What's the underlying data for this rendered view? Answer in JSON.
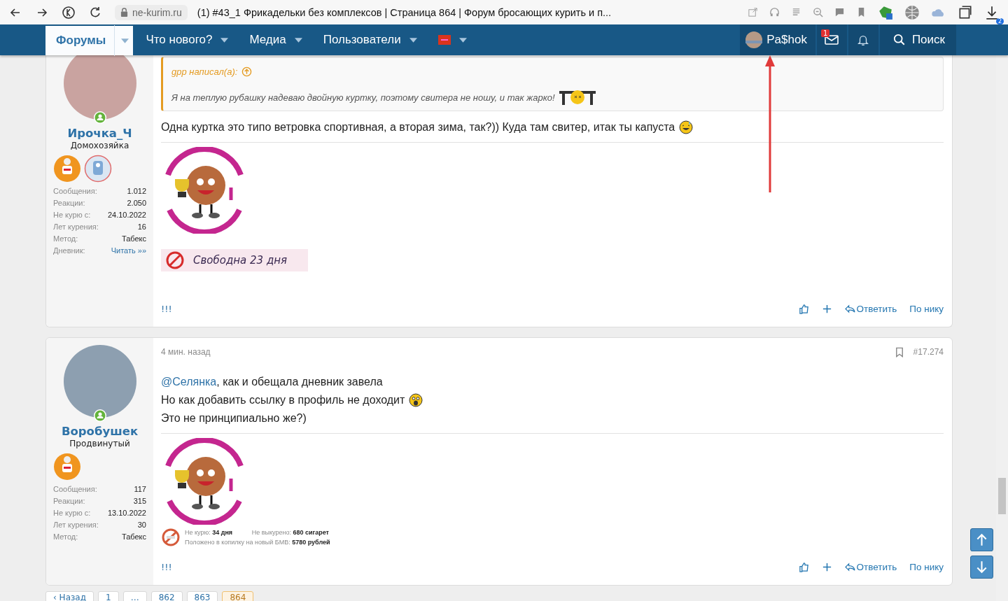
{
  "browser": {
    "url": "ne-kurim.ru",
    "tab_title": "(1) #43_1 Фрикадельки без комплексов | Страница 864 | Форум бросающих курить и п...",
    "downloads_badge": "2"
  },
  "nav": {
    "items": [
      {
        "label": "Форумы",
        "kind": "text",
        "selected": true
      },
      {
        "label": "Что нового?",
        "kind": "text",
        "selected": false
      },
      {
        "label": "Медиа",
        "kind": "text",
        "selected": false
      },
      {
        "label": "Пользователи",
        "kind": "text",
        "selected": false
      },
      {
        "kind": "sos",
        "selected": false
      }
    ],
    "user": "Pa$hok",
    "messages_badge": "1",
    "search": "Поиск"
  },
  "posts": [
    {
      "author": "Ирочка_Ч",
      "title": "Домохозяйка",
      "online": true,
      "awards": [
        {
          "kind": "chef"
        },
        {
          "kind": "robot"
        }
      ],
      "stats": [
        {
          "label": "Сообщения:",
          "value": "1.012",
          "kind": "text"
        },
        {
          "label": "Реакции:",
          "value": "2.050",
          "kind": "text"
        },
        {
          "label": "Не курю с:",
          "value": "24.10.2022",
          "kind": "text"
        },
        {
          "label": "Лет курения:",
          "value": "16",
          "kind": "text"
        },
        {
          "label": "Метод:",
          "value": "Табекс",
          "kind": "text"
        },
        {
          "label": "Дневник:",
          "value": "Читать »»",
          "kind": "link"
        }
      ],
      "quote": {
        "author": "gpp написал(а):",
        "text": "Я на теплую рубашку надеваю двойную куртку, поэтому свитера не ношу, и так жарко!"
      },
      "body": [
        {
          "text": "Одна куртка это типо ветровка спортивная, а вторая зима, так?)) Куда там свитер, итак ты капуста",
          "emoji": {
            "kind": "sweat"
          }
        }
      ],
      "signature": {
        "kind": "banner",
        "lines": [
          "Свободна 23 дня"
        ]
      },
      "footer": "!!!",
      "actions": [
        "Ответить",
        "По нику"
      ]
    },
    {
      "author": "Воробушек",
      "title": "Продвинутый",
      "online": true,
      "awards": [
        {
          "kind": "chef"
        }
      ],
      "time": "4 мин. назад",
      "number": "#17.274",
      "stats": [
        {
          "label": "Сообщения:",
          "value": "117",
          "kind": "text"
        },
        {
          "label": "Реакции:",
          "value": "315",
          "kind": "text"
        },
        {
          "label": "Не курю с:",
          "value": "13.10.2022",
          "kind": "text"
        },
        {
          "label": "Лет курения:",
          "value": "30",
          "kind": "text"
        },
        {
          "label": "Метод:",
          "value": "Табекс",
          "kind": "text"
        }
      ],
      "body": [
        {
          "mention": "@Селянка",
          "text": ", как и обещала дневник завела"
        },
        {
          "text": "Но как добавить ссылку в профиль не доходит",
          "emoji": {
            "kind": "shock"
          }
        },
        {
          "text": "Это не принципиально же?)"
        }
      ],
      "signature": {
        "kind": "counter",
        "lines": [
          "Не курю: **34 дня**",
          "Не выкурено: **680 сигарет**",
          "Положено в копилку на новый БМВ: **5780 рублей**"
        ]
      },
      "footer": "!!!",
      "actions": [
        "Ответить",
        "По нику"
      ]
    }
  ],
  "pagination": [
    {
      "label": "‹ Назад",
      "selected": false
    },
    {
      "label": "1",
      "selected": false
    },
    {
      "label": "…",
      "selected": false
    },
    {
      "label": "862",
      "selected": false
    },
    {
      "label": "863",
      "selected": false
    },
    {
      "label": "864",
      "selected": true
    }
  ]
}
